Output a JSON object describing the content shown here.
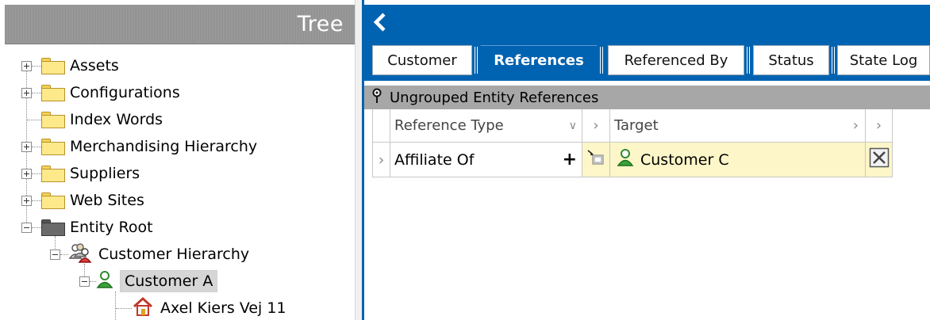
{
  "tree": {
    "title": "Tree",
    "items": [
      {
        "label": "Assets",
        "expander": "plus"
      },
      {
        "label": "Configurations",
        "expander": "plus"
      },
      {
        "label": "Index Words",
        "expander": "none"
      },
      {
        "label": "Merchandising Hierarchy",
        "expander": "plus"
      },
      {
        "label": "Suppliers",
        "expander": "plus"
      },
      {
        "label": "Web Sites",
        "expander": "plus"
      },
      {
        "label": "Entity Root",
        "expander": "minus"
      },
      {
        "label": "Customer Hierarchy",
        "expander": "minus"
      },
      {
        "label": "Customer A",
        "expander": "minus",
        "selected": true
      },
      {
        "label": "Axel Kiers Vej 11",
        "expander": "none"
      }
    ]
  },
  "tabs": [
    {
      "label": "Customer",
      "active": false
    },
    {
      "label": "References",
      "active": true
    },
    {
      "label": "Referenced By",
      "active": false
    },
    {
      "label": "Status",
      "active": false
    },
    {
      "label": "State Log",
      "active": false
    }
  ],
  "group": {
    "label": "Ungrouped Entity References"
  },
  "grid": {
    "headers": {
      "reference_type": "Reference Type",
      "target": "Target"
    },
    "rows": [
      {
        "reference_type": "Affiliate Of",
        "add": "+",
        "target": "Customer C"
      }
    ]
  },
  "colors": {
    "accent": "#0063b1",
    "selection": "#d6d6d6",
    "target_bg": "#fcf6c8"
  }
}
